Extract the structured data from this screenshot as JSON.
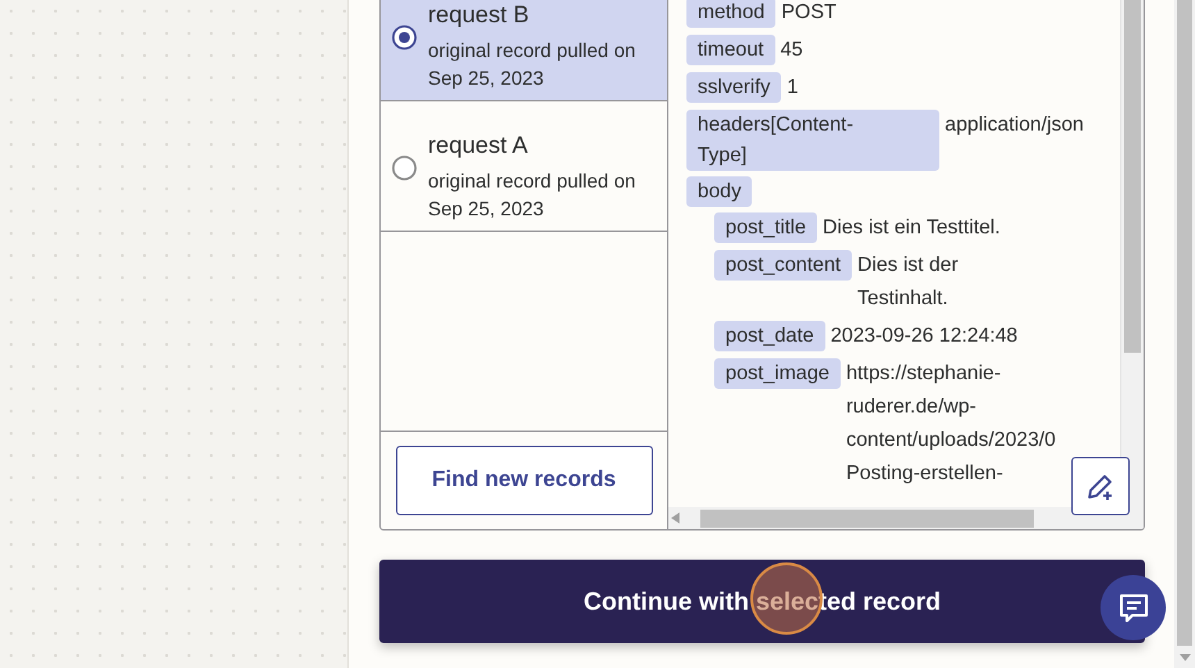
{
  "records": [
    {
      "title": "request B",
      "subtitle": "original record pulled on Sep 25, 2023",
      "selected": true
    },
    {
      "title": "request A",
      "subtitle": "original record pulled on Sep 25, 2023",
      "selected": false
    }
  ],
  "find_button": "Find new records",
  "fields": [
    {
      "key": "method",
      "value": "POST"
    },
    {
      "key": "timeout",
      "value": "45"
    },
    {
      "key": "sslverify",
      "value": "1"
    },
    {
      "key": "headers[Content-Type]",
      "value": "application/json"
    },
    {
      "key": "body",
      "children": [
        {
          "key": "post_title",
          "value": "Dies ist ein Testtitel."
        },
        {
          "key": "post_content",
          "lines": [
            "Dies ist der",
            "Testinhalt."
          ]
        },
        {
          "key": "post_date",
          "value": "2023-09-26 12:24:48"
        },
        {
          "key": "post_image",
          "lines": [
            "https://stephanie-",
            "ruderer.de/wp-",
            "content/uploads/2023/0",
            "Posting-erstellen-"
          ]
        }
      ]
    }
  ],
  "continue_button": "Continue with selected record"
}
